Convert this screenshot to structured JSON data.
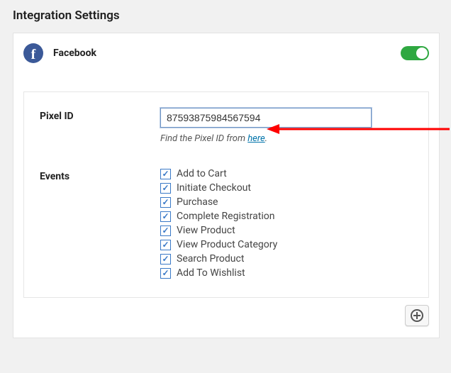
{
  "page": {
    "title": "Integration Settings"
  },
  "integration": {
    "provider": "Facebook",
    "enabled": true
  },
  "pixel": {
    "label": "Pixel ID",
    "value": "87593875984567594",
    "hint_prefix": "Find the Pixel ID from ",
    "hint_link": "here",
    "hint_suffix": "."
  },
  "events": {
    "label": "Events",
    "items": [
      {
        "label": "Add to Cart",
        "checked": true
      },
      {
        "label": "Initiate Checkout",
        "checked": true
      },
      {
        "label": "Purchase",
        "checked": true
      },
      {
        "label": "Complete Registration",
        "checked": true
      },
      {
        "label": "View Product",
        "checked": true
      },
      {
        "label": "View Product Category",
        "checked": true
      },
      {
        "label": "Search Product",
        "checked": true
      },
      {
        "label": "Add To Wishlist",
        "checked": true
      }
    ]
  },
  "colors": {
    "facebook": "#3b5998",
    "toggle_on": "#2fa841",
    "link": "#0073aa",
    "check": "#3a79c7",
    "arrow": "#ff0000"
  }
}
